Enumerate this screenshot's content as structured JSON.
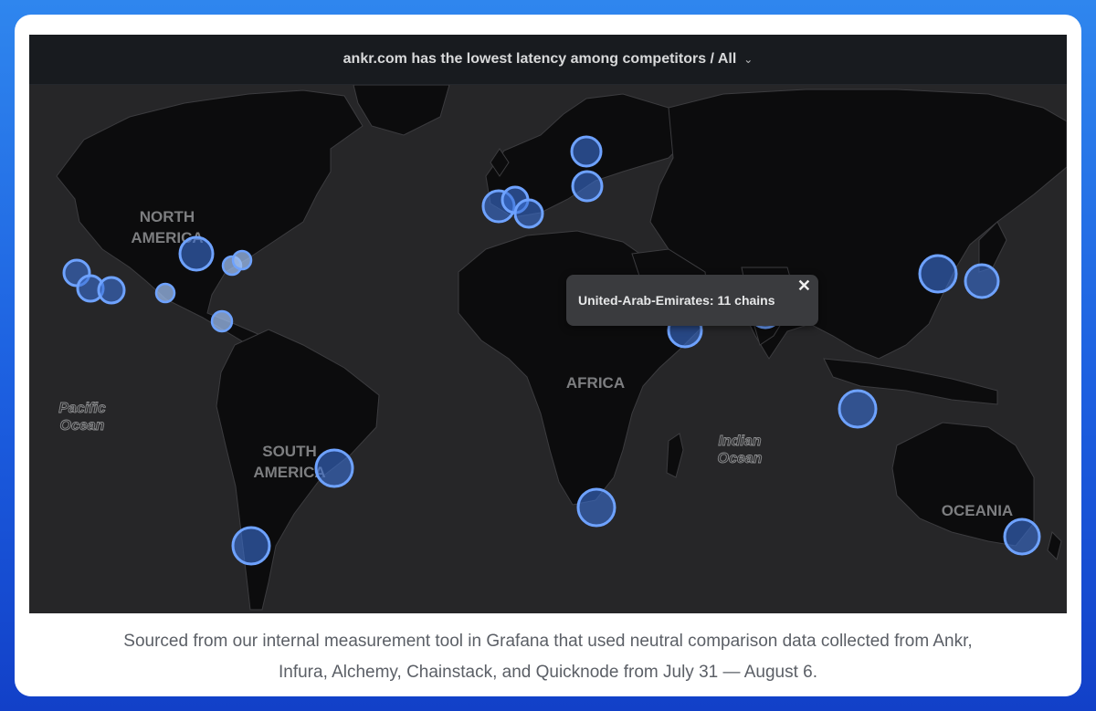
{
  "panel": {
    "title": "ankr.com has the lowest latency among competitors / All",
    "chevron": "⌄"
  },
  "map": {
    "region_labels": {
      "north_america_1": "NORTH",
      "north_america_2": "AMERICA",
      "south_america_1": "SOUTH",
      "south_america_2": "AMERICA",
      "africa": "AFRICA",
      "oceania": "OCEANIA",
      "pacific_1": "Pacific",
      "pacific_2": "Ocean",
      "indian_1": "Indian",
      "indian_2": "Ocean"
    },
    "colors": {
      "water": "#262628",
      "land": "#0c0c0d",
      "border": "#3c3c3f",
      "marker_fill": "#3a6fd4",
      "marker_stroke": "#6ea2ff",
      "marker_light_fill": "#9cbcef",
      "label": "#7d7e80"
    }
  },
  "tooltip": {
    "text": "United-Arab-Emirates: 11 chains",
    "close": "✕"
  },
  "caption": {
    "line1": "Sourced from our internal measurement tool in Grafana that used neutral comparison data collected from Ankr,",
    "line2": "Infura, Alchemy, Chainstack, and Quicknode from July 31 — August 6."
  }
}
